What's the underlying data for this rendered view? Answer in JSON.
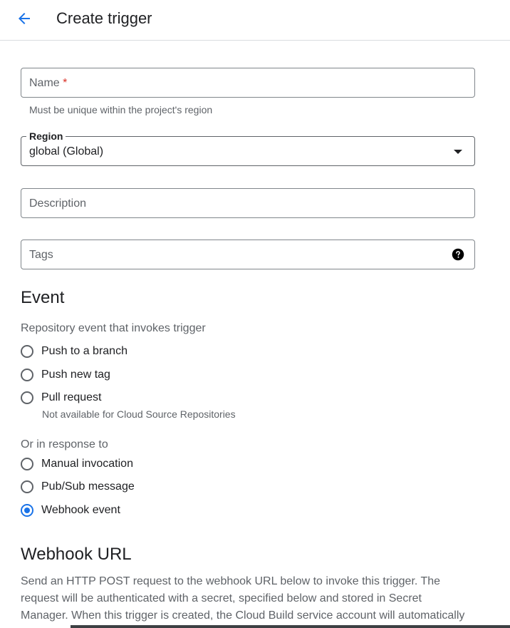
{
  "header": {
    "title": "Create trigger",
    "back_icon": "arrow-back-icon"
  },
  "form": {
    "name": {
      "placeholder": "Name",
      "required_mark": "*",
      "hint": "Must be unique within the project's region"
    },
    "region": {
      "label": "Region",
      "value": "global (Global)"
    },
    "description": {
      "placeholder": "Description"
    },
    "tags": {
      "placeholder": "Tags",
      "help_icon": "help-icon"
    }
  },
  "event": {
    "heading": "Event",
    "repo_label": "Repository event that invokes trigger",
    "repo_options": [
      {
        "label": "Push to a branch",
        "checked": false
      },
      {
        "label": "Push new tag",
        "checked": false
      },
      {
        "label": "Pull request",
        "checked": false,
        "note": "Not available for Cloud Source Repositories"
      }
    ],
    "response_label": "Or in response to",
    "response_options": [
      {
        "label": "Manual invocation",
        "checked": false
      },
      {
        "label": "Pub/Sub message",
        "checked": false
      },
      {
        "label": "Webhook event",
        "checked": true
      }
    ]
  },
  "webhook": {
    "heading": "Webhook URL",
    "description_lines": [
      "Send an HTTP POST request to the webhook URL below to invoke this trigger. The",
      "request will be authenticated with a secret, specified below and stored in Secret",
      "Manager. When this trigger is created, the Cloud Build service account will automatically"
    ]
  },
  "colors": {
    "accent": "#1a73e8",
    "required": "#d93025",
    "border": "#80868b"
  }
}
